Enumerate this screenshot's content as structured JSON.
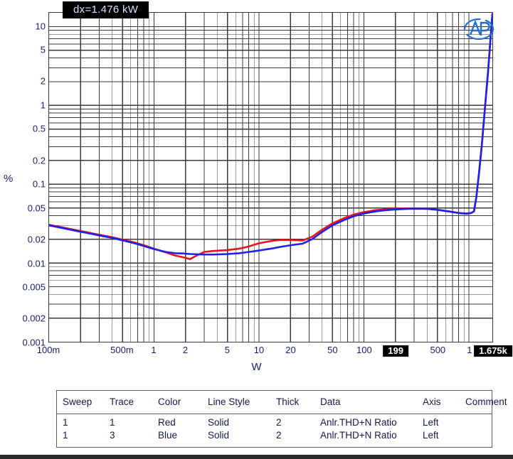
{
  "readout": {
    "dx_label": "dx=1.476 kW"
  },
  "axes": {
    "y_title": "%",
    "x_title": "W",
    "y_ticks": [
      "10",
      "5",
      "2",
      "1",
      "0.5",
      "0.2",
      "0.1",
      "0.05",
      "0.02",
      "0.01",
      "0.005",
      "0.002",
      "0.001"
    ],
    "x_ticks": [
      "100m",
      "500m",
      "1",
      "2",
      "5",
      "10",
      "20",
      "50",
      "100",
      "199",
      "500",
      "1",
      "1.675k"
    ],
    "x_highlighted": [
      "199",
      "1.675k"
    ]
  },
  "watermark": {
    "name": "ap-logo",
    "color": "#1f6fd0"
  },
  "legend": {
    "headers": [
      "Sweep",
      "Trace",
      "Color",
      "Line Style",
      "Thick",
      "Data",
      "Axis",
      "Comment"
    ],
    "rows": [
      {
        "sweep": "1",
        "trace": "1",
        "color": "Red",
        "line_style": "Solid",
        "thick": "2",
        "data": "Anlr.THD+N Ratio",
        "axis": "Left",
        "comment": ""
      },
      {
        "sweep": "1",
        "trace": "3",
        "color": "Blue",
        "line_style": "Solid",
        "thick": "2",
        "data": "Anlr.THD+N Ratio",
        "axis": "Left",
        "comment": ""
      }
    ]
  },
  "colors": {
    "trace_red": "#e8121b",
    "trace_blue": "#1f1fe8",
    "grid": "#3a3a3a",
    "tick_text": "#1c1c6e",
    "badge_bg": "#000000",
    "badge_text": "#cfe3ff"
  },
  "chart_data": {
    "type": "line",
    "title": "",
    "xlabel": "W",
    "ylabel": "%",
    "xscale": "log",
    "yscale": "log",
    "xlim": [
      0.1,
      1675
    ],
    "ylim": [
      0.001,
      15
    ],
    "grid": true,
    "legend_position": "below-table",
    "x_tick_values": [
      0.1,
      0.5,
      1,
      2,
      5,
      10,
      20,
      50,
      100,
      199,
      500,
      1000,
      1675
    ],
    "y_tick_values": [
      10,
      5,
      2,
      1,
      0.5,
      0.2,
      0.1,
      0.05,
      0.02,
      0.01,
      0.005,
      0.002,
      0.001
    ],
    "annotations": [
      {
        "text": "dx=1.476 kW",
        "type": "cursor-delta-readout"
      },
      {
        "text": "199",
        "type": "x-cursor-marker"
      },
      {
        "text": "1.675k",
        "type": "x-cursor-marker"
      }
    ],
    "series": [
      {
        "name": "Anlr.THD+N Ratio (Trace 1)",
        "color": "#e8121b",
        "line_style": "solid",
        "thick": 2,
        "points": [
          [
            0.1,
            0.0305
          ],
          [
            0.13,
            0.0285
          ],
          [
            0.17,
            0.0265
          ],
          [
            0.22,
            0.0248
          ],
          [
            0.3,
            0.0228
          ],
          [
            0.4,
            0.0212
          ],
          [
            0.5,
            0.0198
          ],
          [
            0.65,
            0.0182
          ],
          [
            0.8,
            0.0168
          ],
          [
            1.0,
            0.0152
          ],
          [
            1.3,
            0.0136
          ],
          [
            1.6,
            0.0124
          ],
          [
            1.9,
            0.0118
          ],
          [
            2.2,
            0.0112
          ],
          [
            2.6,
            0.0126
          ],
          [
            3.0,
            0.0138
          ],
          [
            3.6,
            0.0142
          ],
          [
            4.3,
            0.0144
          ],
          [
            5.0,
            0.0146
          ],
          [
            6.5,
            0.0152
          ],
          [
            8.0,
            0.0162
          ],
          [
            10.0,
            0.0178
          ],
          [
            13.0,
            0.019
          ],
          [
            16.0,
            0.0196
          ],
          [
            20.0,
            0.0196
          ],
          [
            26.0,
            0.0193
          ],
          [
            32.0,
            0.0215
          ],
          [
            40.0,
            0.0265
          ],
          [
            50.0,
            0.0318
          ],
          [
            65.0,
            0.0372
          ],
          [
            80.0,
            0.0412
          ],
          [
            100.0,
            0.0443
          ],
          [
            130.0,
            0.0468
          ],
          [
            160.0,
            0.048
          ],
          [
            199.0,
            0.0487
          ],
          [
            260.0,
            0.0492
          ],
          [
            320.0,
            0.0492
          ],
          [
            400.0,
            0.0488
          ],
          [
            500.0,
            0.0475
          ],
          [
            650.0,
            0.0452
          ],
          [
            800.0,
            0.0432
          ],
          [
            950.0,
            0.0424
          ],
          [
            1050.0,
            0.0432
          ],
          [
            1120.0,
            0.0455
          ],
          [
            1180.0,
            0.07
          ],
          [
            1250.0,
            0.14
          ],
          [
            1330.0,
            0.32
          ],
          [
            1420.0,
            0.9
          ],
          [
            1520.0,
            2.6
          ],
          [
            1600.0,
            6.5
          ],
          [
            1675.0,
            14.0
          ]
        ]
      },
      {
        "name": "Anlr.THD+N Ratio (Trace 3)",
        "color": "#1f1fe8",
        "line_style": "solid",
        "thick": 2,
        "points": [
          [
            0.1,
            0.03
          ],
          [
            0.13,
            0.028
          ],
          [
            0.17,
            0.026
          ],
          [
            0.22,
            0.0243
          ],
          [
            0.3,
            0.0224
          ],
          [
            0.4,
            0.0208
          ],
          [
            0.5,
            0.0194
          ],
          [
            0.65,
            0.0178
          ],
          [
            0.8,
            0.0164
          ],
          [
            1.0,
            0.015
          ],
          [
            1.3,
            0.0138
          ],
          [
            1.6,
            0.0133
          ],
          [
            1.9,
            0.0132
          ],
          [
            2.2,
            0.013
          ],
          [
            2.6,
            0.0129
          ],
          [
            3.0,
            0.0128
          ],
          [
            3.6,
            0.0128
          ],
          [
            4.3,
            0.0129
          ],
          [
            5.0,
            0.013
          ],
          [
            6.5,
            0.0133
          ],
          [
            8.0,
            0.0138
          ],
          [
            10.0,
            0.0144
          ],
          [
            13.0,
            0.0152
          ],
          [
            16.0,
            0.016
          ],
          [
            20.0,
            0.0168
          ],
          [
            26.0,
            0.0176
          ],
          [
            32.0,
            0.02
          ],
          [
            40.0,
            0.0248
          ],
          [
            50.0,
            0.03
          ],
          [
            65.0,
            0.0352
          ],
          [
            80.0,
            0.0392
          ],
          [
            100.0,
            0.0425
          ],
          [
            130.0,
            0.0452
          ],
          [
            160.0,
            0.0468
          ],
          [
            199.0,
            0.0478
          ],
          [
            260.0,
            0.0487
          ],
          [
            320.0,
            0.0489
          ],
          [
            400.0,
            0.0486
          ],
          [
            500.0,
            0.0473
          ],
          [
            650.0,
            0.045
          ],
          [
            800.0,
            0.043
          ],
          [
            950.0,
            0.0422
          ],
          [
            1050.0,
            0.043
          ],
          [
            1120.0,
            0.0452
          ],
          [
            1180.0,
            0.069
          ],
          [
            1250.0,
            0.138
          ],
          [
            1330.0,
            0.315
          ],
          [
            1420.0,
            0.89
          ],
          [
            1520.0,
            2.55
          ],
          [
            1600.0,
            6.4
          ],
          [
            1675.0,
            14.5
          ]
        ]
      }
    ]
  }
}
